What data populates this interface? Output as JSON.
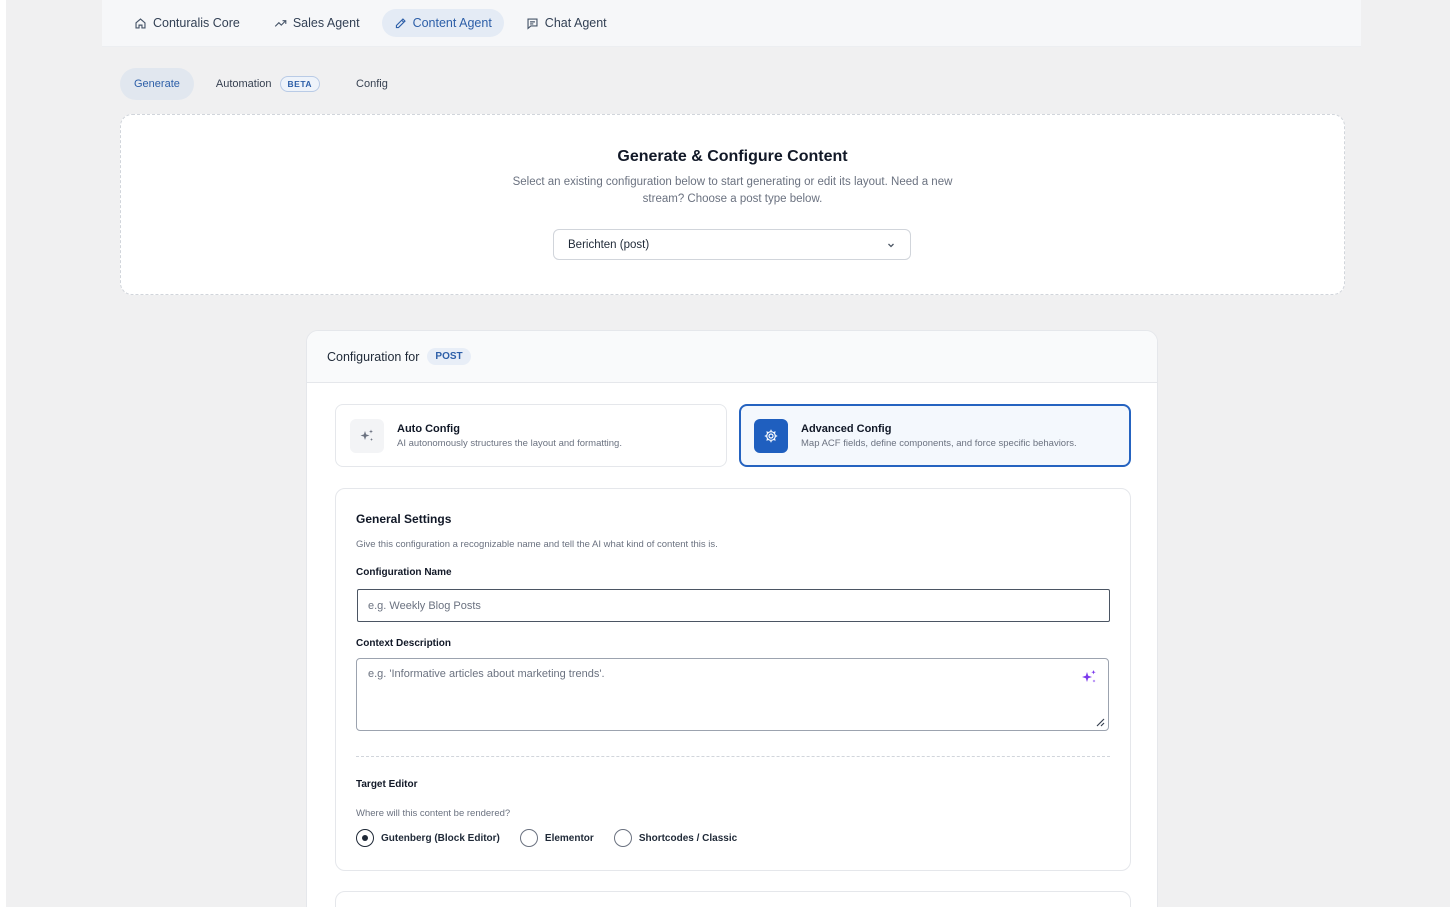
{
  "nav": {
    "items": [
      {
        "label": "Conturalis Core",
        "icon": "home-icon"
      },
      {
        "label": "Sales Agent",
        "icon": "trend-up-icon"
      },
      {
        "label": "Content Agent",
        "icon": "pencil-icon",
        "active": true
      },
      {
        "label": "Chat Agent",
        "icon": "chat-icon"
      }
    ]
  },
  "subtabs": {
    "generate": "Generate",
    "automation": "Automation",
    "beta": "BETA",
    "config": "Config"
  },
  "hero": {
    "title": "Generate & Configure Content",
    "subtitle": "Select an existing configuration below to start generating or edit its layout. Need a new stream? Choose a post type below.",
    "select_value": "Berichten (post)"
  },
  "panel": {
    "heading": "Configuration for",
    "badge": "POST",
    "auto": {
      "title": "Auto Config",
      "desc": "AI autonomously structures the layout and formatting."
    },
    "advanced": {
      "title": "Advanced Config",
      "desc": "Map ACF fields, define components, and force specific behaviors."
    }
  },
  "settings": {
    "title": "General Settings",
    "desc": "Give this configuration a recognizable name and tell the AI what kind of content this is.",
    "name_label": "Configuration Name",
    "name_placeholder": "e.g. Weekly Blog Posts",
    "context_label": "Context Description",
    "context_placeholder": "e.g. 'Informative articles about marketing trends'.",
    "editor_label": "Target Editor",
    "editor_desc": "Where will this content be rendered?",
    "editor_options": [
      "Gutenberg (Block Editor)",
      "Elementor",
      "Shortcodes / Classic"
    ],
    "editor_selected": "Gutenberg (Block Editor)"
  },
  "colors": {
    "accent": "#2563c0",
    "active_tab_bg": "#e4ebf5",
    "sparkle": "#7c3aed"
  }
}
